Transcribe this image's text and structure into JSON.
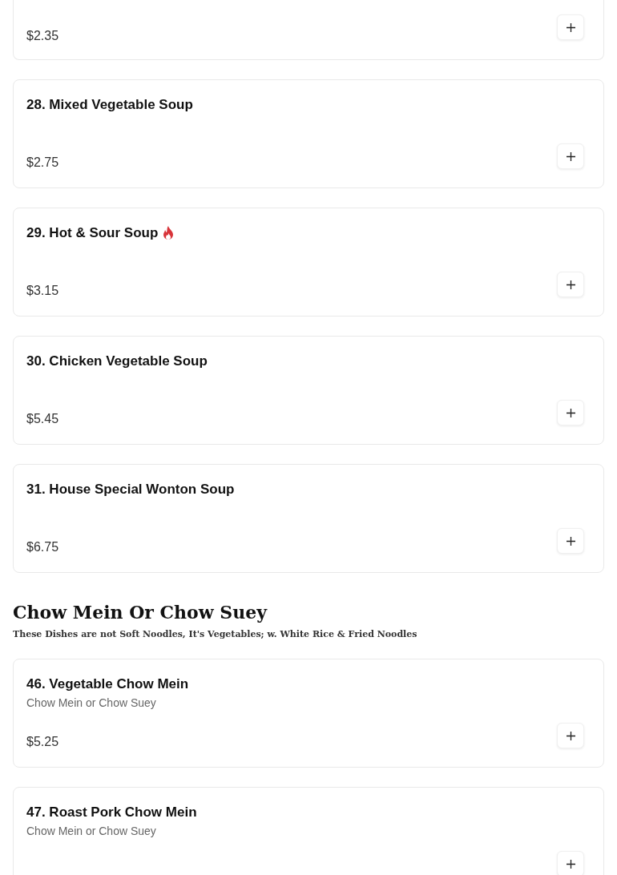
{
  "sections": [
    {
      "items": [
        {
          "price": "$2.35",
          "cut_top": true
        },
        {
          "name": "28. Mixed Vegetable Soup",
          "price": "$2.75",
          "spicy": false
        },
        {
          "name": "29. Hot & Sour Soup",
          "price": "$3.15",
          "spicy": true
        },
        {
          "name": "30. Chicken Vegetable Soup",
          "price": "$5.45",
          "spicy": false
        },
        {
          "name": "31. House Special Wonton Soup",
          "price": "$6.75",
          "spicy": false
        }
      ]
    },
    {
      "title": "Chow Mein Or Chow Suey",
      "subtitle": "These Dishes are not Soft Noodles, It's Vegetables; w. White Rice & Fried Noodles",
      "items": [
        {
          "name": "46. Vegetable Chow Mein",
          "description": "Chow Mein or Chow Suey",
          "price": "$5.25",
          "spicy": false
        },
        {
          "name": "47. Roast Pork Chow Mein",
          "description": "Chow Mein or Chow Suey",
          "spicy": false
        }
      ]
    }
  ]
}
